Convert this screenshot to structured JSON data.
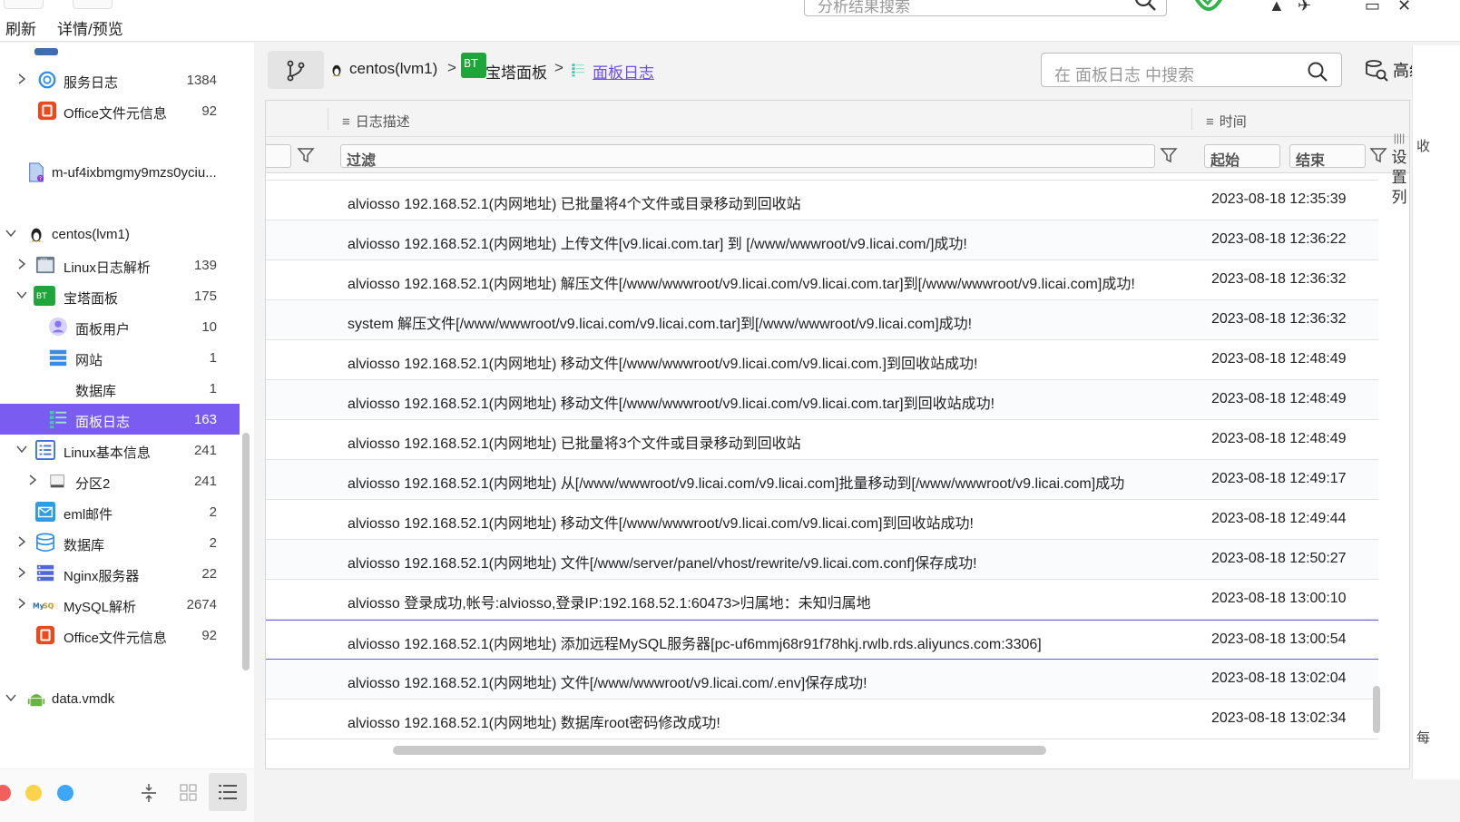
{
  "toolbar": {
    "refresh_label": "刷新",
    "details_label": "详情/预览",
    "search_placeholder": "分析结果搜索"
  },
  "sidebar": {
    "items": [
      {
        "label": "服务日志",
        "count": "1384"
      },
      {
        "label": "Office文件元信息",
        "count": "92"
      },
      {
        "label": "m-uf4ixbmgmy9mzs0yciu...",
        "count": ""
      },
      {
        "label": "centos(lvm1)",
        "count": ""
      },
      {
        "label": "Linux日志解析",
        "count": "139"
      },
      {
        "label": "宝塔面板",
        "count": "175"
      },
      {
        "label": "面板用户",
        "count": "10"
      },
      {
        "label": "网站",
        "count": "1"
      },
      {
        "label": "数据库",
        "count": "1"
      },
      {
        "label": "面板日志",
        "count": "163"
      },
      {
        "label": "Linux基本信息",
        "count": "241"
      },
      {
        "label": "分区2",
        "count": "241"
      },
      {
        "label": "eml邮件",
        "count": "2"
      },
      {
        "label": "数据库",
        "count": "2"
      },
      {
        "label": "Nginx服务器",
        "count": "22"
      },
      {
        "label": "MySQL解析",
        "count": "2674"
      },
      {
        "label": "Office文件元信息",
        "count": "92"
      },
      {
        "label": "data.vmdk",
        "count": ""
      }
    ]
  },
  "breadcrumb": {
    "root": "centos(lvm1)",
    "sep": ">",
    "mid": "宝塔面板",
    "current": "面板日志",
    "bt_badge": "BT"
  },
  "search": {
    "placeholder": "在 面板日志 中搜索",
    "advanced_label": "高级"
  },
  "table": {
    "columns": {
      "desc": "日志描述",
      "time": "时间"
    },
    "filter": {
      "desc": "过滤",
      "start": "起始",
      "end": "结束"
    },
    "settings_label": [
      "设",
      "置",
      "列"
    ],
    "rows": [
      {
        "desc": "alviosso 192.168.52.1(内网地址) 已批量将4个文件或目录移动到回收站",
        "time": "2023-08-18 12:35:39"
      },
      {
        "desc": "alviosso 192.168.52.1(内网地址) 上传文件[v9.licai.com.tar] 到 [/www/wwwroot/v9.licai.com/]成功!",
        "time": "2023-08-18 12:36:22"
      },
      {
        "desc": "alviosso 192.168.52.1(内网地址) 解压文件[/www/wwwroot/v9.licai.com/v9.licai.com.tar]到[/www/wwwroot/v9.licai.com]成功!",
        "time": "2023-08-18 12:36:32"
      },
      {
        "desc": "system 解压文件[/www/wwwroot/v9.licai.com/v9.licai.com.tar]到[/www/wwwroot/v9.licai.com]成功!",
        "time": "2023-08-18 12:36:32"
      },
      {
        "desc": "alviosso 192.168.52.1(内网地址) 移动文件[/www/wwwroot/v9.licai.com/v9.licai.com.]到回收站成功!",
        "time": "2023-08-18 12:48:49"
      },
      {
        "desc": "alviosso 192.168.52.1(内网地址) 移动文件[/www/wwwroot/v9.licai.com/v9.licai.com.tar]到回收站成功!",
        "time": "2023-08-18 12:48:49"
      },
      {
        "desc": "alviosso 192.168.52.1(内网地址) 已批量将3个文件或目录移动到回收站",
        "time": "2023-08-18 12:48:49"
      },
      {
        "desc": "alviosso 192.168.52.1(内网地址) 从[/www/wwwroot/v9.licai.com/v9.licai.com]批量移动到[/www/wwwroot/v9.licai.com]成功",
        "time": "2023-08-18 12:49:17"
      },
      {
        "desc": "alviosso 192.168.52.1(内网地址) 移动文件[/www/wwwroot/v9.licai.com/v9.licai.com]到回收站成功!",
        "time": "2023-08-18 12:49:44"
      },
      {
        "desc": "alviosso 192.168.52.1(内网地址) 文件[/www/server/panel/vhost/rewrite/v9.licai.com.conf]保存成功!",
        "time": "2023-08-18 12:50:27"
      },
      {
        "desc": "alviosso 登录成功,帐号:alviosso,登录IP:192.168.52.1:60473>归属地：未知归属地",
        "time": "2023-08-18 13:00:10"
      },
      {
        "desc": "alviosso 192.168.52.1(内网地址) 添加远程MySQL服务器[pc-uf6mmj68r91f78hkj.rwlb.rds.aliyuncs.com:3306]",
        "time": "2023-08-18 13:00:54"
      },
      {
        "desc": "alviosso 192.168.52.1(内网地址) 文件[/www/wwwroot/v9.licai.com/.env]保存成功!",
        "time": "2023-08-18 13:02:04"
      },
      {
        "desc": "alviosso 192.168.52.1(内网地址) 数据库root密码修改成功!",
        "time": "2023-08-18 13:02:34"
      }
    ]
  },
  "right_edge": {
    "top": "收",
    "bottom": "每"
  },
  "colors": {
    "accent": "#7b5cf0",
    "bt_green": "#20a53a",
    "dot_red": "#f25f5c",
    "dot_yellow": "#fbd44b",
    "dot_blue": "#3ea7f5"
  }
}
